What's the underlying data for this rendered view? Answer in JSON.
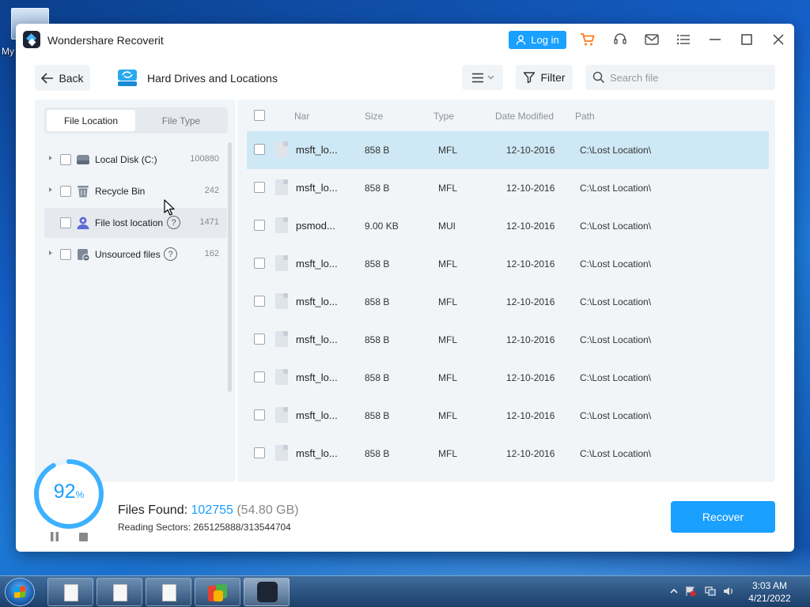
{
  "desktop": {
    "label": "My"
  },
  "window": {
    "title": "Wondershare Recoverit",
    "login_label": "Log in"
  },
  "toolbar": {
    "back_label": "Back",
    "location_title": "Hard Drives and Locations",
    "filter_label": "Filter",
    "search_placeholder": "Search file"
  },
  "sidebar": {
    "tabs": [
      {
        "label": "File Location",
        "active": true
      },
      {
        "label": "File Type",
        "active": false
      }
    ],
    "items": [
      {
        "label": "Local Disk (C:)",
        "count": "100880",
        "icon": "disk-icon"
      },
      {
        "label": "Recycle Bin",
        "count": "242",
        "icon": "recycle-bin-icon"
      },
      {
        "label": "File lost location",
        "count": "1471",
        "icon": "lost-location-icon",
        "help": "?"
      },
      {
        "label": "Unsourced files",
        "count": "162",
        "icon": "unsourced-files-icon",
        "help": "?"
      }
    ]
  },
  "file_list": {
    "columns": [
      "Nar",
      "Size",
      "Type",
      "Date Modified",
      "Path"
    ],
    "rows": [
      {
        "name": "msft_lo...",
        "size": "858 B",
        "type": "MFL",
        "date": "12-10-2016",
        "path": "C:\\Lost Location\\",
        "selected": true
      },
      {
        "name": "msft_lo...",
        "size": "858 B",
        "type": "MFL",
        "date": "12-10-2016",
        "path": "C:\\Lost Location\\"
      },
      {
        "name": "psmod...",
        "size": "9.00 KB",
        "type": "MUI",
        "date": "12-10-2016",
        "path": "C:\\Lost Location\\"
      },
      {
        "name": "msft_lo...",
        "size": "858 B",
        "type": "MFL",
        "date": "12-10-2016",
        "path": "C:\\Lost Location\\"
      },
      {
        "name": "msft_lo...",
        "size": "858 B",
        "type": "MFL",
        "date": "12-10-2016",
        "path": "C:\\Lost Location\\"
      },
      {
        "name": "msft_lo...",
        "size": "858 B",
        "type": "MFL",
        "date": "12-10-2016",
        "path": "C:\\Lost Location\\"
      },
      {
        "name": "msft_lo...",
        "size": "858 B",
        "type": "MFL",
        "date": "12-10-2016",
        "path": "C:\\Lost Location\\"
      },
      {
        "name": "msft_lo...",
        "size": "858 B",
        "type": "MFL",
        "date": "12-10-2016",
        "path": "C:\\Lost Location\\"
      },
      {
        "name": "msft_lo...",
        "size": "858 B",
        "type": "MFL",
        "date": "12-10-2016",
        "path": "C:\\Lost Location\\"
      }
    ]
  },
  "status": {
    "progress_value": "92",
    "progress_unit": "%",
    "progress_fraction": 0.92,
    "files_found_label": "Files Found:",
    "files_found_count": "102755",
    "files_found_size": "(54.80 GB)",
    "reading_sectors": "Reading Sectors: 265125888/313544704",
    "recover_label": "Recover"
  },
  "taskbar": {
    "time": "3:03 AM",
    "date": "4/21/2022"
  },
  "colors": {
    "accent": "#1aa0ff",
    "selected_row": "#cfe8f5",
    "panel_bg": "#f2f5f8"
  }
}
